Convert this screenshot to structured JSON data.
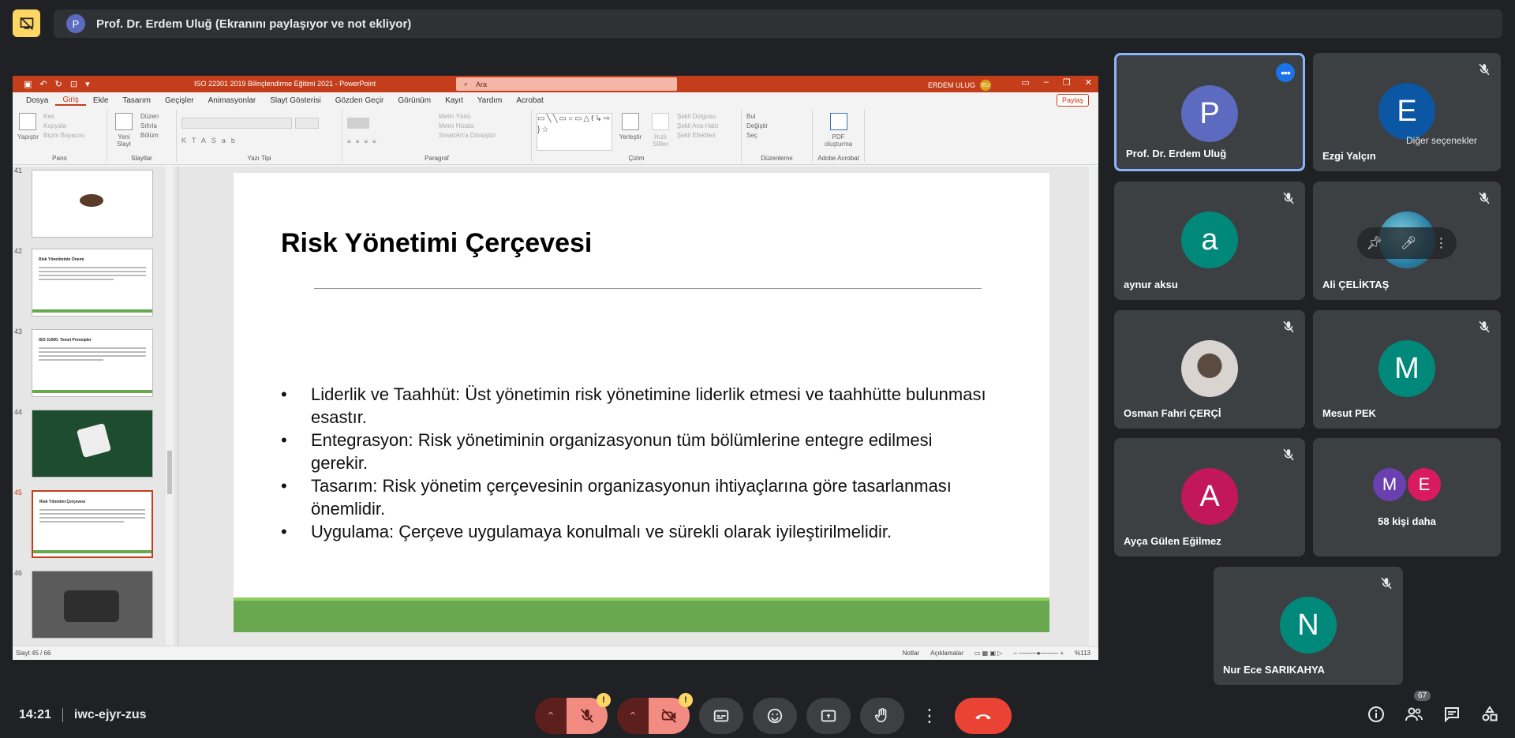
{
  "presenter_bar": {
    "avatar_letter": "P",
    "text": "Prof. Dr. Erdem Uluğ (Ekranını paylaşıyor ve not ekliyor)"
  },
  "ppt": {
    "doc_title": "ISO 22301 2019 Bilinçlendirme Eğitimi 2021  -  PowerPoint",
    "search_placeholder": "Ara",
    "user_name": "ERDEM ULUG",
    "user_initials": "EU",
    "menu": [
      "Dosya",
      "Giriş",
      "Ekle",
      "Tasarım",
      "Geçişler",
      "Animasyonlar",
      "Slayt Gösterisi",
      "Gözden Geçir",
      "Görünüm",
      "Kayıt",
      "Yardım",
      "Acrobat"
    ],
    "share_label": "Paylaş",
    "ribbon": {
      "pano": {
        "label": "Pano",
        "paste": "Yapıştır",
        "cut": "Kes",
        "copy": "Kopyala",
        "format_painter": "Biçim Boyacısı"
      },
      "slaytlar": {
        "label": "Slaytlar",
        "new_slide": "Yeni Slayt",
        "layout": "Düzen",
        "reset": "Sıfırla",
        "section": "Bölüm"
      },
      "yazi_tipi": {
        "label": "Yazı Tipi"
      },
      "paragraf": {
        "label": "Paragraf",
        "text_direction": "Metin Yönü",
        "align_text": "Metni Hizala",
        "smartart": "SmartArt'a Dönüştür"
      },
      "cizim": {
        "label": "Çizim",
        "arrange": "Yerleştir",
        "quick_styles": "Hızlı Stiller",
        "fill": "Şekil Dolgusu",
        "outline": "Şekil Ana Hattı",
        "effects": "Şekil Efektleri"
      },
      "duzenleme": {
        "label": "Düzenleme",
        "find": "Bul",
        "replace": "Değiştir",
        "select": "Seç"
      },
      "acrobat": {
        "label": "Adobe Acrobat",
        "create_pdf": "PDF oluşturma"
      }
    },
    "thumbnails": [
      {
        "num": "41",
        "kind": "photo-light",
        "title": ""
      },
      {
        "num": "42",
        "kind": "text",
        "title": "Risk Yönetiminin Önemi"
      },
      {
        "num": "43",
        "kind": "text",
        "title": "ISO 31000: Temel Prensipler"
      },
      {
        "num": "44",
        "kind": "dark",
        "title": ""
      },
      {
        "num": "45",
        "kind": "text-selected",
        "title": "Risk Yönetimi Çerçevesi"
      },
      {
        "num": "46",
        "kind": "photo",
        "title": ""
      }
    ],
    "slide": {
      "title": "Risk Yönetimi Çerçevesi",
      "bullets": [
        "Liderlik ve Taahhüt: Üst yönetimin risk yönetimine liderlik etmesi ve taahhütte bulunması esastır.",
        "Entegrasyon: Risk yönetiminin organizasyonun tüm bölümlerine entegre edilmesi gerekir.",
        "Tasarım: Risk yönetim çerçevesinin organizasyonun ihtiyaçlarına göre tasarlanması önemlidir.",
        "Uygulama: Çerçeve uygulamaya konulmalı ve sürekli olarak iyileştirilmelidir."
      ]
    },
    "status": {
      "slide_count": "Slayt 45 / 66",
      "notes": "Notlar",
      "comments": "Açıklamalar",
      "zoom": "%113"
    }
  },
  "participants": [
    {
      "name": "Prof. Dr. Erdem Uluğ",
      "letter": "P",
      "color": "#5c6bc0",
      "active": true
    },
    {
      "name": "Ezgi Yalçın",
      "letter": "E",
      "color": "#0b57a4",
      "tooltip": "Diğer seçenekler"
    },
    {
      "name": "aynur aksu",
      "letter": "a",
      "color": "#00897b"
    },
    {
      "name": "Ali ÇELİKTAŞ",
      "letter": "",
      "color": "#2a7fa5"
    },
    {
      "name": "Osman Fahri ÇERÇİ",
      "letter": "",
      "color": "#cccccc"
    },
    {
      "name": "Mesut PEK",
      "letter": "M",
      "color": "#00897b"
    },
    {
      "name": "Ayça Gülen Eğilmez",
      "letter": "A",
      "color": "#c2185b"
    },
    {
      "name": "58 kişi daha",
      "letter": "",
      "color": ""
    },
    {
      "name": "Nur Ece SARIKAHYA",
      "letter": "N",
      "color": "#00897b"
    }
  ],
  "more_avatars": [
    {
      "letter": "M",
      "color": "#6a3fb0"
    },
    {
      "letter": "E",
      "color": "#d81b60"
    }
  ],
  "bottom": {
    "time": "14:21",
    "meeting_code": "iwc-ejyr-zus",
    "participant_count": "67"
  }
}
